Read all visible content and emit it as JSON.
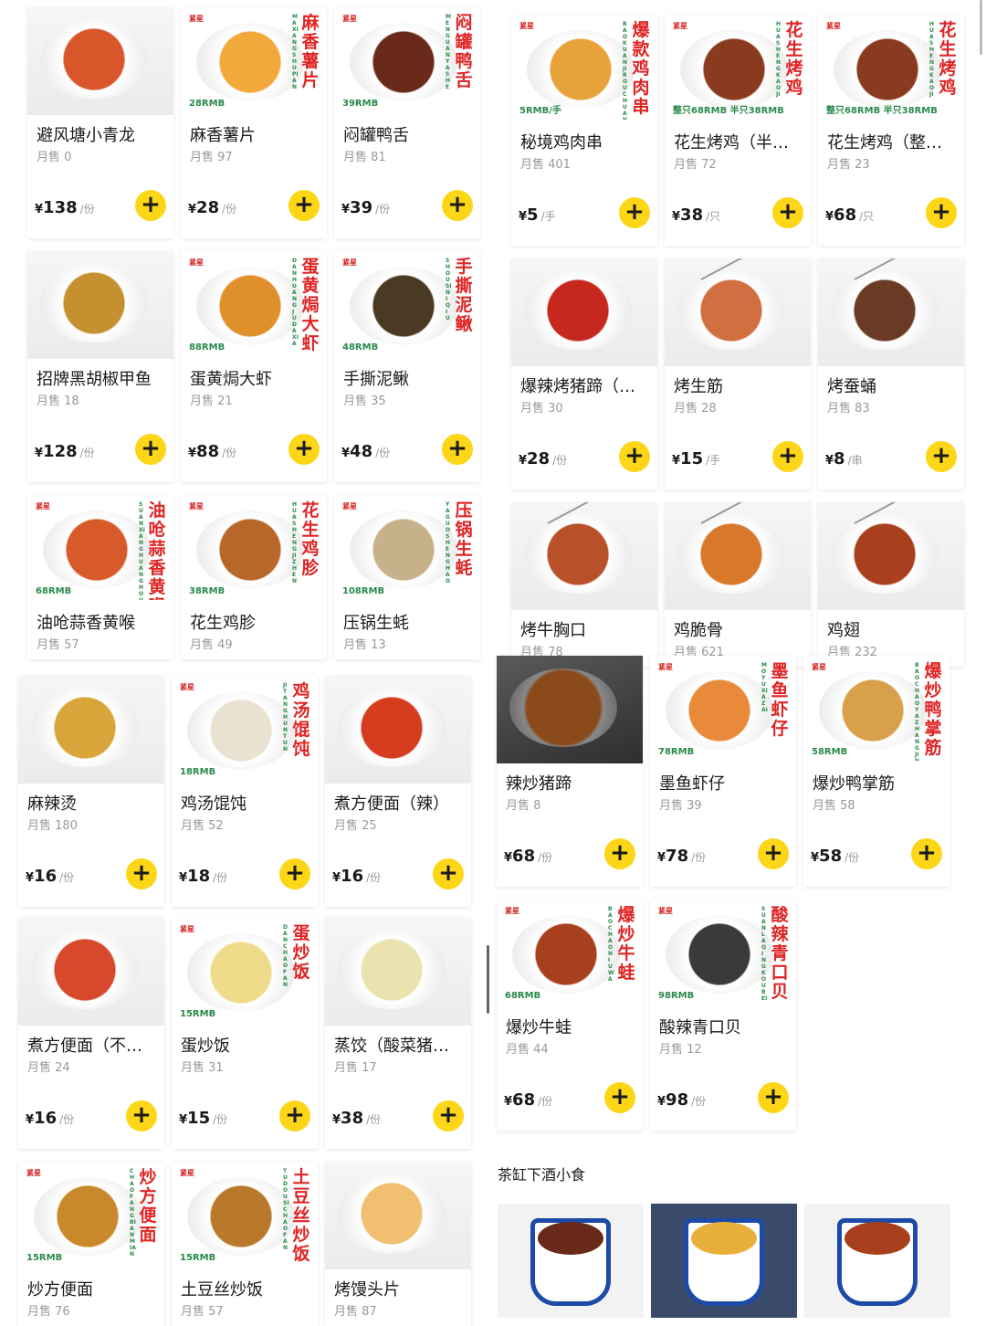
{
  "colors": {
    "accent_yellow": "#fcd617",
    "promo_red": "#e02424",
    "promo_green": "#2a8a4a"
  },
  "brand_text": "紧星",
  "section_title": "茶缸下酒小食",
  "left": [
    {
      "name": "避风塘小青龙",
      "sales": "月售 0",
      "price": "138",
      "unit": "/份",
      "img": "photo",
      "food": "#d9552a"
    },
    {
      "name": "麻香薯片",
      "sales": "月售 97",
      "price": "28",
      "unit": "/份",
      "img": "promo",
      "food": "#f2a93b",
      "vt": "麻香薯片",
      "pinyin": "MAXIANGSHUPIAN",
      "ptag": "28RMB"
    },
    {
      "name": "闷罐鸭舌",
      "sales": "月售 81",
      "price": "39",
      "unit": "/份",
      "img": "promo",
      "food": "#6a2a1a",
      "vt": "闷罐鸭舌",
      "pinyin": "MENGUANYASHE",
      "ptag": "39RMB"
    },
    {
      "name": "招牌黑胡椒甲鱼",
      "sales": "月售 18",
      "price": "128",
      "unit": "/份",
      "img": "photo",
      "food": "#c5902f"
    },
    {
      "name": "蛋黄焗大虾",
      "sales": "月售 21",
      "price": "88",
      "unit": "/份",
      "img": "promo",
      "food": "#e0902a",
      "vt": "蛋黄焗大虾",
      "pinyin": "DANHUANGJUDAXIA",
      "ptag": "88RMB"
    },
    {
      "name": "手撕泥鳅",
      "sales": "月售 35",
      "price": "48",
      "unit": "/份",
      "img": "promo",
      "food": "#4a3a24",
      "vt": "手撕泥鳅",
      "pinyin": "SHOUSINIQIU",
      "ptag": "48RMB"
    },
    {
      "name": "油呛蒜香黄喉",
      "sales": "月售 57",
      "price": "",
      "unit": "",
      "img": "promo",
      "food": "#d85a2a",
      "vt": "油呛蒜香黄喉",
      "pinyin": "SUANXIANGHUANGHOU",
      "ptag": "68RMB",
      "short": true
    },
    {
      "name": "花生鸡胗",
      "sales": "月售 49",
      "price": "",
      "unit": "",
      "img": "promo",
      "food": "#b8672a",
      "vt": "花生鸡胗",
      "pinyin": "HUASHENGJIZHEN",
      "ptag": "38RMB",
      "short": true
    },
    {
      "name": "压锅生蚝",
      "sales": "月售 13",
      "price": "",
      "unit": "",
      "img": "promo",
      "food": "#c7b18a",
      "vt": "压锅生蚝",
      "pinyin": "YAGUOSHENGHAO",
      "ptag": "108RMB",
      "short": true
    },
    {
      "name": "麻辣烫",
      "sales": "月售 180",
      "price": "16",
      "unit": "/份",
      "img": "photo",
      "food": "#d8a53a"
    },
    {
      "name": "鸡汤馄饨",
      "sales": "月售 52",
      "price": "18",
      "unit": "/份",
      "img": "promo",
      "food": "#e9e2d0",
      "vt": "鸡汤馄饨",
      "pinyin": "JITANGHUNTUN",
      "ptag": "18RMB"
    },
    {
      "name": "煮方便面（辣）",
      "sales": "月售 25",
      "price": "16",
      "unit": "/份",
      "img": "photo",
      "food": "#d63c1e"
    },
    {
      "name": "煮方便面（不…",
      "sales": "月售 24",
      "price": "16",
      "unit": "/份",
      "img": "photo",
      "food": "#d8482a"
    },
    {
      "name": "蛋炒饭",
      "sales": "月售 31",
      "price": "15",
      "unit": "/份",
      "img": "promo",
      "food": "#efdc8a",
      "vt": "蛋炒饭",
      "pinyin": "DANCHAOFAN",
      "ptag": "15RMB"
    },
    {
      "name": "蒸饺（酸菜猪…",
      "sales": "月售 17",
      "price": "38",
      "unit": "/份",
      "img": "photo",
      "food": "#eae3b0"
    },
    {
      "name": "炒方便面",
      "sales": "月售 76",
      "price": "",
      "unit": "",
      "img": "promo",
      "food": "#c9882a",
      "vt": "炒方便面",
      "pinyin": "CHAOFANGBIANMIAN",
      "ptag": "15RMB",
      "short": true
    },
    {
      "name": "土豆丝炒饭",
      "sales": "月售 57",
      "price": "",
      "unit": "",
      "img": "promo",
      "food": "#b9782a",
      "vt": "土豆丝炒饭",
      "pinyin": "TUDOUSICHAOFAN",
      "ptag": "15RMB",
      "short": true
    },
    {
      "name": "烤馒头片",
      "sales": "月售 87",
      "price": "",
      "unit": "",
      "img": "photo",
      "food": "#f0c070",
      "short": true
    }
  ],
  "right": [
    {
      "name": "秘境鸡肉串",
      "sales": "月售 401",
      "price": "5",
      "unit": "/手",
      "img": "promo",
      "food": "#e8a23a",
      "vt": "爆款鸡肉串",
      "pinyin": "BAOKUANJIROUCHUAN",
      "ptag": "5RMB/手"
    },
    {
      "name": "花生烤鸡（半…",
      "sales": "月售 72",
      "price": "38",
      "unit": "/只",
      "img": "promo",
      "food": "#8a3a1e",
      "vt": "花生烤鸡",
      "pinyin": "HUASHENGKAOJI",
      "ptag": "整只68RMB 半只38RMB"
    },
    {
      "name": "花生烤鸡（整…",
      "sales": "月售 23",
      "price": "68",
      "unit": "/只",
      "img": "promo",
      "food": "#8a3a1e",
      "vt": "花生烤鸡",
      "pinyin": "HUASHENGKAOJI",
      "ptag": "整只68RMB 半只38RMB"
    },
    {
      "name": "爆辣烤猪蹄（…",
      "sales": "月售 30",
      "price": "28",
      "unit": "/份",
      "img": "photo",
      "food": "#c6281e"
    },
    {
      "name": "烤生筋",
      "sales": "月售 28",
      "price": "15",
      "unit": "/手",
      "img": "photo",
      "food": "#d07040",
      "skewer": true
    },
    {
      "name": "烤蚕蛹",
      "sales": "月售 83",
      "price": "8",
      "unit": "/串",
      "img": "photo",
      "food": "#6a3a24",
      "skewer": true
    },
    {
      "name": "烤牛胸口",
      "sales": "月售 78",
      "price": "",
      "unit": "",
      "img": "photo",
      "food": "#b8502a",
      "skewer": true,
      "short": true
    },
    {
      "name": "鸡脆骨",
      "sales": "月售 621",
      "price": "",
      "unit": "",
      "img": "photo",
      "food": "#d8782a",
      "skewer": true,
      "short": true
    },
    {
      "name": "鸡翅",
      "sales": "月售 232",
      "price": "",
      "unit": "",
      "img": "photo",
      "food": "#a8401e",
      "skewer": true,
      "short": true
    },
    {
      "name": "辣炒猪蹄",
      "sales": "月售 8",
      "price": "68",
      "unit": "/份",
      "img": "dark",
      "food": "#8a4a1a"
    },
    {
      "name": "墨鱼虾仔",
      "sales": "月售 39",
      "price": "78",
      "unit": "/份",
      "img": "promo",
      "food": "#e88a3a",
      "vt": "墨鱼虾仔",
      "pinyin": "MOYUXIAZAI",
      "ptag": "78RMB"
    },
    {
      "name": "爆炒鸭掌筋",
      "sales": "月售 58",
      "price": "58",
      "unit": "/份",
      "img": "promo",
      "food": "#d8a04a",
      "vt": "爆炒鸭掌筋",
      "pinyin": "BAOCHAOYAZHANGJIN",
      "ptag": "58RMB"
    },
    {
      "name": "爆炒牛蛙",
      "sales": "月售 44",
      "price": "68",
      "unit": "/份",
      "img": "promo",
      "food": "#a8401e",
      "vt": "爆炒牛蛙",
      "pinyin": "BAOCHAONIUWA",
      "ptag": "68RMB"
    },
    {
      "name": "酸辣青口贝",
      "sales": "月售 12",
      "price": "98",
      "unit": "/份",
      "img": "promo",
      "food": "#3a3a3a",
      "vt": "酸辣青口贝",
      "pinyin": "SUANLAQINGKOUBEI",
      "ptag": "98RMB"
    }
  ],
  "mugs": [
    {
      "food": "#6a2a1a"
    },
    {
      "food": "#e8b03a"
    },
    {
      "food": "#a8401e"
    }
  ]
}
